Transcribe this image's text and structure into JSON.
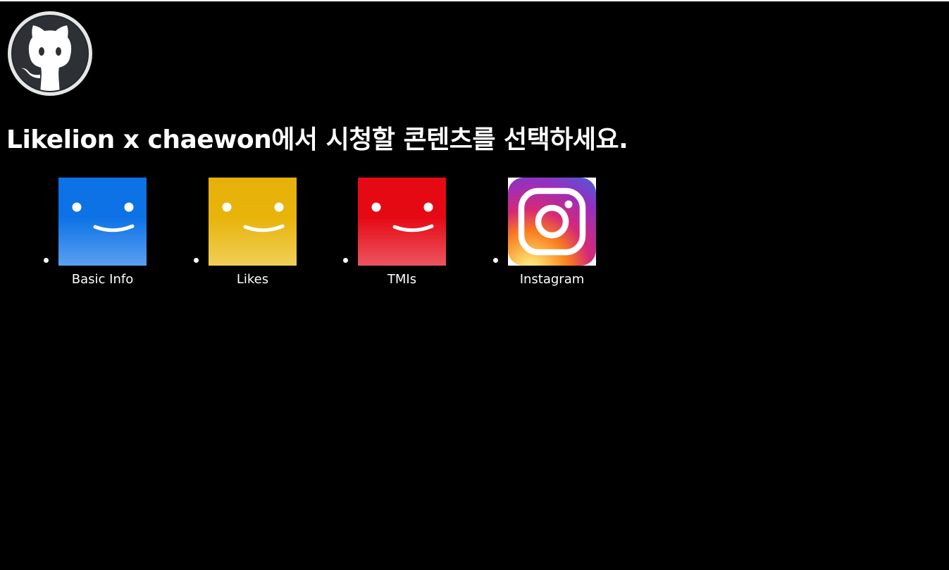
{
  "header": {
    "logo_icon": "github-octocat-icon",
    "title": "Likelion x chaewon에서 시청할 콘텐츠를 선택하세요."
  },
  "profiles": [
    {
      "label": "Basic Info",
      "icon": "smiley-avatar-icon",
      "colors": [
        "#0c72e6",
        "#5aa0f0"
      ]
    },
    {
      "label": "Likes",
      "icon": "smiley-avatar-icon",
      "colors": [
        "#e8b40a",
        "#f0cf58"
      ]
    },
    {
      "label": "TMIs",
      "icon": "smiley-avatar-icon",
      "colors": [
        "#e50914",
        "#ec5560"
      ]
    },
    {
      "label": "Instagram",
      "icon": "instagram-icon",
      "colors": [
        "#feda75",
        "#fa7e1e",
        "#d62976",
        "#962fbf",
        "#4f5bd5"
      ]
    }
  ]
}
